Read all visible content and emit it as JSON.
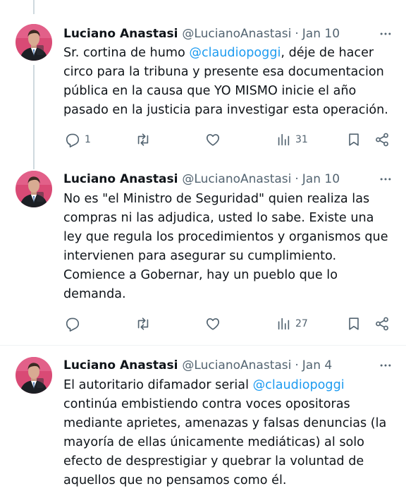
{
  "tweets": [
    {
      "author_name": "Luciano Anastasi",
      "handle": "@LucianoAnastasi",
      "separator": "·",
      "date": "Jan 10",
      "text_before": "Sr. cortina de humo ",
      "mention": "@claudiopoggi",
      "text_after": ", déje de hacer\ncirco para la tribuna y presente esa documentacion\npública en la causa que YO MISMO inicie el año\npasado en la justicia para investigar esta operación.",
      "reply_count": "1",
      "repost_count": "",
      "like_count": "",
      "view_count": "31"
    },
    {
      "author_name": "Luciano Anastasi",
      "handle": "@LucianoAnastasi",
      "separator": "·",
      "date": "Jan 10",
      "text_before": "No es \"el Ministro de Seguridad\" quien realiza las\ncompras ni las adjudica, usted lo sabe. Existe una\nley que regula los procedimientos y organismos que\nintervienen para asegurar su cumplimiento.\nComience a Gobernar, hay un pueblo que lo\ndemanda.",
      "mention": "",
      "text_after": "",
      "reply_count": "",
      "repost_count": "",
      "like_count": "",
      "view_count": "27"
    },
    {
      "author_name": "Luciano Anastasi",
      "handle": "@LucianoAnastasi",
      "separator": "·",
      "date": "Jan 4",
      "text_before": "El autoritario difamador serial ",
      "mention": "@claudiopoggi",
      "text_after": "\ncontinúa embistiendo contra voces opositoras\nmediante aprietes, amenazas y falsas denuncias (la\nmayoría de ellas únicamente mediáticas) al solo\nefecto de desprestigiar y quebrar la voluntad de\naquellos que no pensamos como él.",
      "reply_count": "",
      "repost_count": "",
      "like_count": "",
      "view_count": ""
    }
  ],
  "icons": {
    "more": "more-horizontal-icon",
    "reply": "reply-icon",
    "repost": "repost-icon",
    "like": "like-icon",
    "views": "views-icon",
    "bookmark": "bookmark-icon",
    "share": "share-icon"
  },
  "colors": {
    "text": "#0f1419",
    "secondary": "#536471",
    "mention": "#1d9bf0",
    "thread_line": "#cfd9de",
    "avatar_bg": "#d94a75"
  }
}
